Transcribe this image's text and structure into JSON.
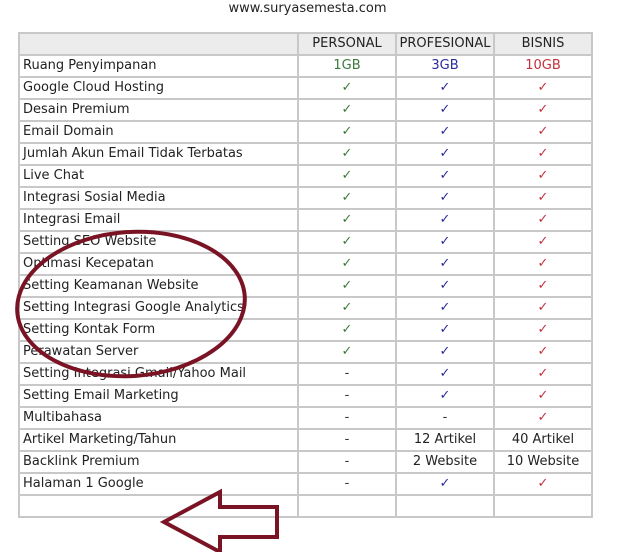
{
  "site_url": "www.suryasemesta.com",
  "table": {
    "headers": [
      "",
      "PERSONAL",
      "PROFESIONAL",
      "BISNIS"
    ],
    "plan_colors": {
      "personal": "#3c7a3c",
      "profesional": "#2b2b9c",
      "bisnis": "#c3303c"
    },
    "rows": [
      {
        "feature": "Ruang Penyimpanan",
        "personal": "1GB",
        "profesional": "3GB",
        "bisnis": "10GB"
      },
      {
        "feature": "Google Cloud Hosting",
        "personal": "✓",
        "profesional": "✓",
        "bisnis": "✓"
      },
      {
        "feature": "Desain Premium",
        "personal": "✓",
        "profesional": "✓",
        "bisnis": "✓"
      },
      {
        "feature": "Email Domain",
        "personal": "✓",
        "profesional": "✓",
        "bisnis": "✓"
      },
      {
        "feature": "Jumlah Akun Email Tidak Terbatas",
        "personal": "✓",
        "profesional": "✓",
        "bisnis": "✓"
      },
      {
        "feature": "Live Chat",
        "personal": "✓",
        "profesional": "✓",
        "bisnis": "✓"
      },
      {
        "feature": "Integrasi Sosial Media",
        "personal": "✓",
        "profesional": "✓",
        "bisnis": "✓"
      },
      {
        "feature": "Integrasi Email",
        "personal": "✓",
        "profesional": "✓",
        "bisnis": "✓"
      },
      {
        "feature": "Setting SEO Website",
        "personal": "✓",
        "profesional": "✓",
        "bisnis": "✓"
      },
      {
        "feature": "Optimasi Kecepatan",
        "personal": "✓",
        "profesional": "✓",
        "bisnis": "✓"
      },
      {
        "feature": "Setting Keamanan Website",
        "personal": "✓",
        "profesional": "✓",
        "bisnis": "✓"
      },
      {
        "feature": "Setting Integrasi Google Analytics",
        "personal": "✓",
        "profesional": "✓",
        "bisnis": "✓"
      },
      {
        "feature": "Setting Kontak Form",
        "personal": "✓",
        "profesional": "✓",
        "bisnis": "✓"
      },
      {
        "feature": "Perawatan Server",
        "personal": "✓",
        "profesional": "✓",
        "bisnis": "✓"
      },
      {
        "feature": "Setting Integrasi Gmail/Yahoo Mail",
        "personal": "-",
        "profesional": "✓",
        "bisnis": "✓"
      },
      {
        "feature": "Setting Email Marketing",
        "personal": "-",
        "profesional": "✓",
        "bisnis": "✓"
      },
      {
        "feature": "Multibahasa",
        "personal": "-",
        "profesional": "-",
        "bisnis": "✓"
      },
      {
        "feature": "Artikel Marketing/Tahun",
        "personal": "-",
        "profesional": "12 Artikel",
        "bisnis": "40 Artikel"
      },
      {
        "feature": "Backlink Premium",
        "personal": "-",
        "profesional": "2 Website",
        "bisnis": "10 Website"
      },
      {
        "feature": "Halaman 1 Google",
        "personal": "-",
        "profesional": "✓",
        "bisnis": "✓"
      },
      {
        "feature": "",
        "personal": "",
        "profesional": "",
        "bisnis": ""
      }
    ]
  },
  "annotations": {
    "color": "#7a1424",
    "circle_highlight": "Setting SEO Website – Setting Kontak Form",
    "arrow_points_to": "Halaman 1 Google"
  }
}
